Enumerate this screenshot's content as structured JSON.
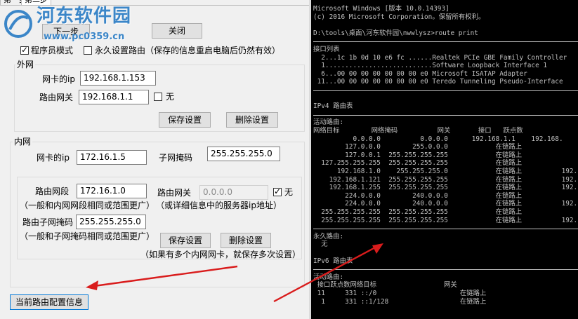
{
  "tabs": [
    "第一步",
    "第二步"
  ],
  "watermark": {
    "title": "河东软件园",
    "url": "www.pc0359.cn"
  },
  "top_buttons": {
    "next": "下一步",
    "close": "关闭"
  },
  "options": {
    "programmer_mode": "程序员模式",
    "programmer_mode_checked": true,
    "persistent": "永久设置路由（保存的信息重启电脑后仍然有效）",
    "persistent_checked": false
  },
  "external": {
    "title": "外网",
    "nic_ip_label": "网卡的ip",
    "nic_ip_value": "192.168.1.153",
    "gateway_label": "路由网关",
    "gateway_value": "192.168.1.1",
    "none_label": "无",
    "none_checked": false,
    "save": "保存设置",
    "delete": "删除设置"
  },
  "internal": {
    "title": "内网",
    "nic_ip_label": "网卡的ip",
    "nic_ip_value": "172.16.1.5",
    "mask_label": "子网掩码",
    "mask_value": "255.255.255.0",
    "segment_label": "路由网段",
    "segment_value": "172.16.1.0",
    "segment_hint": "（一般和内网网段相同或范围更广）",
    "route_gateway_label": "路由网关",
    "route_gateway_value": "0.0.0.0",
    "none_label": "无",
    "none_checked": true,
    "route_gateway_hint": "（或详细信息中的服务器ip地址）",
    "submask_label": "路由子网掩码",
    "submask_value": "255.255.255.0",
    "submask_hint": "（一般和子网掩码相同或范围更广）",
    "save": "保存设置",
    "delete": "删除设置",
    "multi_hint": "（如果有多个内网网卡，就保存多次设置）"
  },
  "current_config_button": "当前路由配置信息",
  "console": {
    "lines": [
      "Microsoft Windows [版本 10.0.14393]",
      "(c) 2016 Microsoft Corporation。保留所有权利。",
      "",
      "D:\\tools\\桌面\\河东软件园\\nwwlysz>route print",
      "===========================================================",
      "接口列表",
      "  2...1c 1b 0d 10 e6 fc ......Realtek PCIe GBE Family Controller",
      "  1...........................Software Loopback Interface 1",
      "  6...00 00 00 00 00 00 00 e0 Microsoft ISATAP Adapter",
      " 11...00 00 00 00 00 00 00 e0 Teredo Tunneling Pseudo-Interface",
      "===========================================================",
      "",
      "IPv4 路由表",
      "===========================================================",
      "活动路由:",
      "网络目标        网络掩码          网关       接口   跃点数",
      "          0.0.0.0          0.0.0.0      192.168.1.1    192.168.",
      "        127.0.0.0        255.0.0.0            在链路上",
      "        127.0.0.1  255.255.255.255            在链路上",
      "  127.255.255.255  255.255.255.255            在链路上",
      "      192.168.1.0    255.255.255.0            在链路上          192.",
      "    192.168.1.121  255.255.255.255            在链路上          192.",
      "    192.168.1.255  255.255.255.255            在链路上          192.",
      "        224.0.0.0        240.0.0.0            在链路上",
      "        224.0.0.0        240.0.0.0            在链路上          192.",
      "  255.255.255.255  255.255.255.255            在链路上",
      "  255.255.255.255  255.255.255.255            在链路上          192.",
      "===========================================================",
      "永久路由:",
      "  无",
      "",
      "IPv6 路由表",
      "===========================================================",
      "活动路由:",
      " 接口跃点数网络目标                 网关",
      " 11     331 ::/0                     在链路上",
      "  1     331 ::1/128                  在链路上"
    ]
  }
}
